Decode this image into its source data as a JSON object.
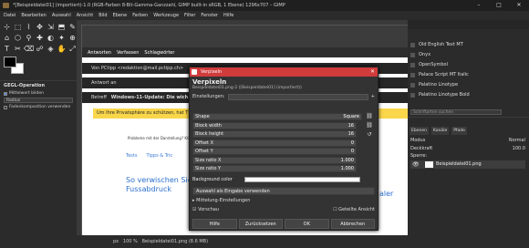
{
  "window": {
    "title": "*[Beispieldatei01] (importiert)-1.0 (RGB-Farben 8-Bit-Gamma-Ganzzahl, GIMP built-in sRGB, 1 Ebene) 1296x707 – GIMP",
    "minimize": "–",
    "maximize": "□",
    "close": "✕"
  },
  "menu": [
    "Datei",
    "Bearbeiten",
    "Auswahl",
    "Ansicht",
    "Bild",
    "Ebene",
    "Farben",
    "Werkzeuge",
    "Filter",
    "Fenster",
    "Hilfe"
  ],
  "toolbox": {
    "icons": [
      "⊹",
      "⬚",
      "⌇",
      "✥",
      "⇲",
      "⬒",
      "✎",
      "⌂",
      "⬡",
      "⚲",
      "✚",
      "◐",
      "✦",
      "⊕",
      "T",
      "✂",
      "⌫",
      "☍",
      "◈",
      "✋",
      "⤢"
    ]
  },
  "tool_options": {
    "title": "GEGL-Operation",
    "items": [
      "Mittelwert bilden",
      "Radius",
      "Fadenkomposition verwenden"
    ],
    "radius_label": "Radius"
  },
  "canvas": {
    "mail_buttons": [
      "Antworten",
      "Verfassen",
      "Schlagwörter"
    ],
    "from_row": "Von PCtipp <redaktion@mail.pctipp.ch>",
    "reply_row": "Antwort an",
    "subject_label": "Betreff",
    "subject": "Windows-11-Update: Die wich",
    "hint": "Um Ihre Privatsphäre zu schützen, hat T",
    "article_q": "Probleme mit der Darstellung? Klicken",
    "tabs": [
      "Tests",
      "Tipps & Tric"
    ],
    "headline": "So verwischen Sie Fussabdruck",
    "headline2": "aler"
  },
  "dialog": {
    "window_title": "Verpixeln",
    "close": "✕",
    "title": "Verpixeln",
    "subtitle": "Beispieldatei01.png-2 ([Beispieldatei01] (importiert))",
    "presets_label": "Einstellungen:",
    "fields": [
      {
        "label": "Shape",
        "value": "Square"
      },
      {
        "label": "Block width",
        "value": "16"
      },
      {
        "label": "Block height",
        "value": "16"
      },
      {
        "label": "Offset X",
        "value": "0"
      },
      {
        "label": "Offset Y",
        "value": "0"
      },
      {
        "label": "Size ratio X",
        "value": "1.000"
      },
      {
        "label": "Size ratio Y",
        "value": "1.000"
      }
    ],
    "bg_label": "Background color",
    "combo": "Auswahl als Eingabe verwenden",
    "blend": "Mittelung-Einstellungen",
    "preview": "Vorschau",
    "split": "Geteilte Ansicht",
    "buttons": [
      "Hilfe",
      "Zurücksetzen",
      "OK",
      "Abbrechen"
    ]
  },
  "fonts": {
    "list": [
      "Old English Text MT",
      "Onyx",
      "OpenSymbol",
      "Palace Script MT Italic",
      "Palatino Linotype",
      "Palatino Linotype Bold"
    ],
    "search_placeholder": "Schriftarten suchen"
  },
  "layers": {
    "tabs": [
      "Ebenen",
      "Kanäle",
      "Pfade"
    ],
    "mode_label": "Modus",
    "mode": "Normal",
    "opacity_label": "Deckkraft",
    "opacity": "100.0",
    "lock_label": "Sperre:",
    "layer_name": "Beispieldatei01.png"
  },
  "status": {
    "unit": "px",
    "zoom": "100 %",
    "text": "Beispieldatei01.png (8.6 MB)"
  }
}
